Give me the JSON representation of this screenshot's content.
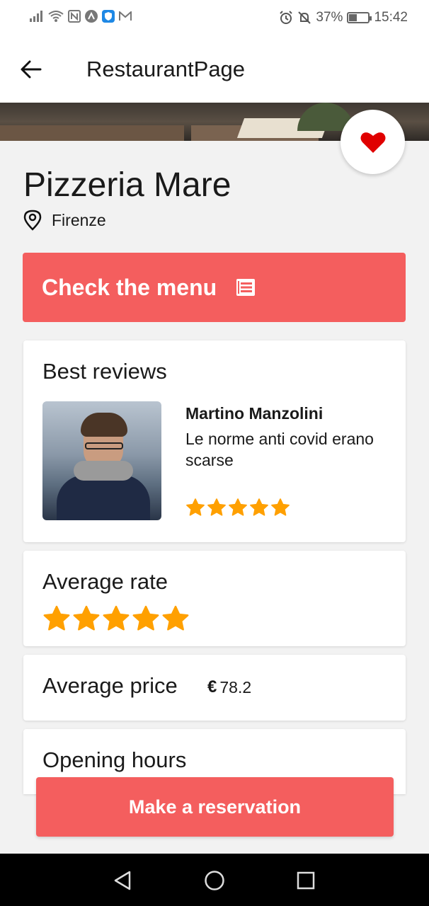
{
  "status_bar": {
    "battery_percent": "37%",
    "battery_level": 0.37,
    "time": "15:42",
    "icons_left": [
      "signal-icon",
      "wifi-icon",
      "nfc-icon",
      "android-icon",
      "shield-icon",
      "mail-icon"
    ],
    "icons_right": [
      "alarm-icon",
      "silent-icon",
      "battery-icon"
    ]
  },
  "app_bar": {
    "title": "RestaurantPage"
  },
  "restaurant": {
    "name": "Pizzeria Mare",
    "location": "Firenze",
    "favorite": true
  },
  "menu_button": {
    "label": "Check the menu"
  },
  "reviews": {
    "title": "Best reviews",
    "reviewer_name": "Martino Manzolini",
    "text": "Le norme anti covid erano scarse",
    "rating": 5
  },
  "average_rate": {
    "title": "Average rate",
    "rating": 5
  },
  "average_price": {
    "title": "Average price",
    "currency": "€",
    "value": "78.2"
  },
  "opening_hours": {
    "title": "Opening hours"
  },
  "reservation_button": {
    "label": "Make a reservation"
  },
  "colors": {
    "accent": "#f45e5e",
    "star": "#ffa000",
    "heart": "#e00000"
  }
}
